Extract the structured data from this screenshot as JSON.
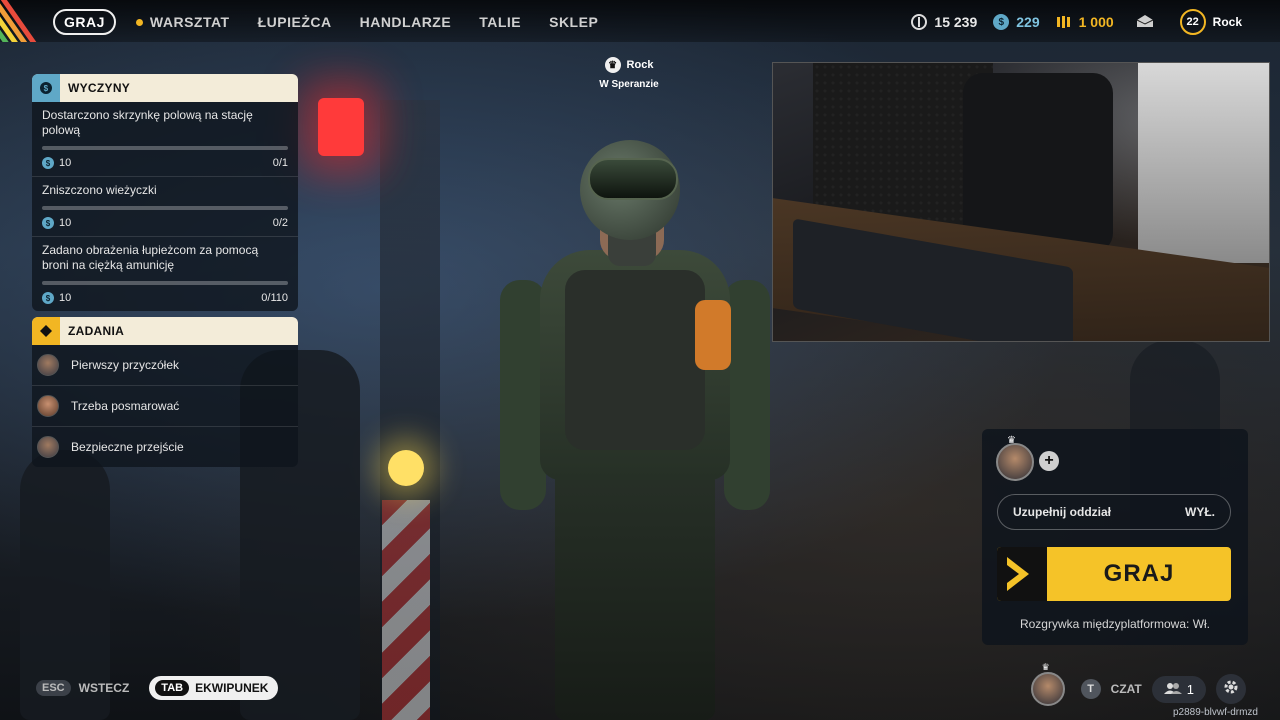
{
  "nav": {
    "items": [
      {
        "label": "GRAJ",
        "active": true
      },
      {
        "label": "WARSZTAT",
        "dot": true
      },
      {
        "label": "ŁUPIEŻCA"
      },
      {
        "label": "HANDLARZE"
      },
      {
        "label": "TALIE"
      },
      {
        "label": "SKLEP"
      }
    ]
  },
  "currencies": {
    "credits": "15 239",
    "tokens": "229",
    "raider_coins": "1 000",
    "level": "22",
    "username": "Rock",
    "icons": [
      "credits-icon",
      "token-icon",
      "raider-coin-icon",
      "inbox-icon"
    ]
  },
  "player_tag": {
    "name": "Rock",
    "location": "W Speranzie"
  },
  "challenges": {
    "title": "WYCZYNY",
    "items": [
      {
        "title": "Dostarczono skrzynkę polową na stację polową",
        "reward": "10",
        "progress": "0/1",
        "fraction": 0
      },
      {
        "title": "Zniszczono wieżyczki",
        "reward": "10",
        "progress": "0/2",
        "fraction": 0
      },
      {
        "title": "Zadano obrażenia łupieżcom za pomocą broni na ciężką amunicję",
        "reward": "10",
        "progress": "0/110",
        "fraction": 0
      }
    ]
  },
  "tasks": {
    "title": "ZADANIA",
    "items": [
      {
        "label": "Pierwszy przyczółek"
      },
      {
        "label": "Trzeba posmarować"
      },
      {
        "label": "Bezpieczne przejście"
      }
    ]
  },
  "squad": {
    "fill_label": "Uzupełnij oddział",
    "fill_value": "WYŁ.",
    "play_label": "GRAJ",
    "crossplay": "Rozgrywka międzyplatformowa: Wł."
  },
  "bottom": {
    "esc_key": "ESC",
    "esc_label": "WSTECZ",
    "tab_key": "TAB",
    "tab_label": "EKWIPUNEK",
    "chat_key": "T",
    "chat_label": "CZAT",
    "friends_count": "1",
    "session_id": "p2889-blvwf-drmzd"
  },
  "colors": {
    "accent": "#f5c328",
    "panel_header": "#f3ecd9",
    "challenge_icon_bg": "#5fa8c7",
    "task_icon_bg": "#f2b623"
  }
}
